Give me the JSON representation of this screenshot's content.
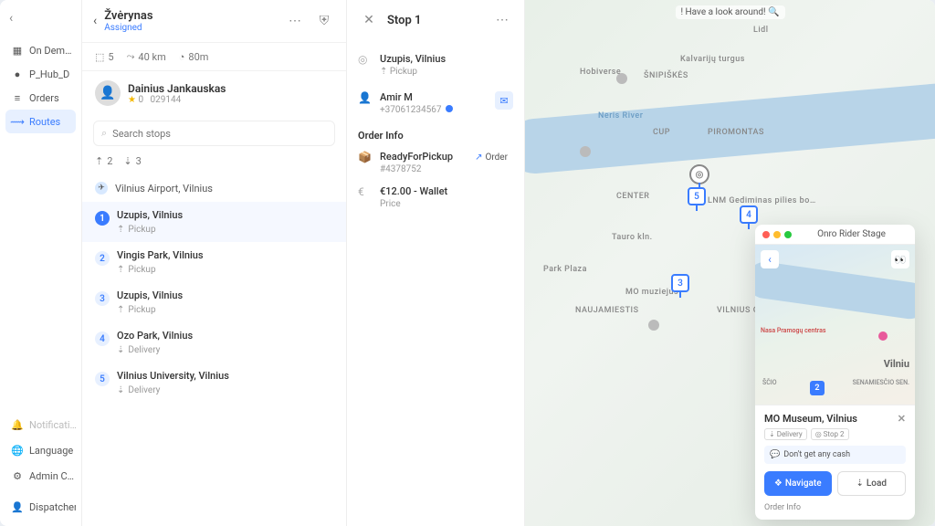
{
  "sidebar": {
    "items": [
      {
        "label": "On Dem…",
        "icon": "grid"
      },
      {
        "label": "P_Hub_D",
        "icon": "dot"
      },
      {
        "label": "Orders",
        "icon": "list"
      },
      {
        "label": "Routes",
        "icon": "route",
        "active": true
      }
    ],
    "bottom": [
      {
        "label": "Notificati…",
        "icon": "bell"
      },
      {
        "label": "Language",
        "icon": "globe"
      },
      {
        "label": "Admin C…",
        "icon": "gear"
      },
      {
        "label": "Dispatcher",
        "icon": "user"
      }
    ]
  },
  "route": {
    "name": "Žvėrynas",
    "status": "Assigned",
    "stats": {
      "stops": "5",
      "distance": "40 km",
      "duration": "80m"
    },
    "driver": {
      "name": "Dainius Jankauskas",
      "id": "029144",
      "rating": "0"
    },
    "search_placeholder": "Search stops",
    "filters": {
      "pickups": "2",
      "deliveries": "3"
    },
    "origin": "Vilnius Airport, Vilnius",
    "stops": [
      {
        "num": "1",
        "addr": "Uzupis, Vilnius",
        "type": "Pickup",
        "active": true
      },
      {
        "num": "2",
        "addr": "Vingis Park, Vilnius",
        "type": "Pickup"
      },
      {
        "num": "3",
        "addr": "Uzupis, Vilnius",
        "type": "Pickup"
      },
      {
        "num": "4",
        "addr": "Ozo Park, Vilnius",
        "type": "Delivery"
      },
      {
        "num": "5",
        "addr": "Vilnius University, Vilnius",
        "type": "Delivery"
      }
    ]
  },
  "detail": {
    "title": "Stop 1",
    "location": "Uzupis, Vilnius",
    "location_type": "Pickup",
    "contact": {
      "name": "Amir M",
      "phone": "+37061234567"
    },
    "order_section": "Order Info",
    "order": {
      "status": "ReadyForPickup",
      "id": "#4378752",
      "btn": "Order"
    },
    "price": {
      "amount": "€12.00 - Wallet",
      "label": "Price"
    }
  },
  "map": {
    "banner": "! Have a look around! 🔍",
    "labels": {
      "snipiskes": "ŠNIPIŠKĖS",
      "piromontas": "PIROMONTAS",
      "center": "CENTER",
      "naujamiestis": "NAUJAMIESTIS",
      "oldtown": "VILNIUS OLD TOWN",
      "river": "Neris River",
      "lidl": "Lidl",
      "cup": "CUP",
      "mo": "MO muziejus",
      "tauro": "Tauro kln.",
      "plaza": "Park Plaza",
      "hobiverse": "Hobiverse",
      "turgus": "Kalvarijų turgus",
      "lnm": "LNM Gediminas pilies bo…"
    },
    "pins": {
      "p3": "3",
      "p4": "4",
      "p5": "5"
    }
  },
  "phone": {
    "title": "Onro Rider Stage",
    "city": "Vilniu",
    "sub1": "ŠČIO",
    "sub2": "SENAMIESČIO SEN.",
    "poi": "Nasa Pramogų centras",
    "pin": "2",
    "location": "MO Museum, Vilnius",
    "tags": [
      "Delivery",
      "Stop 2"
    ],
    "note": "Don't get any cash",
    "navigate": "Navigate",
    "load": "Load",
    "order_info": "Order Info"
  }
}
